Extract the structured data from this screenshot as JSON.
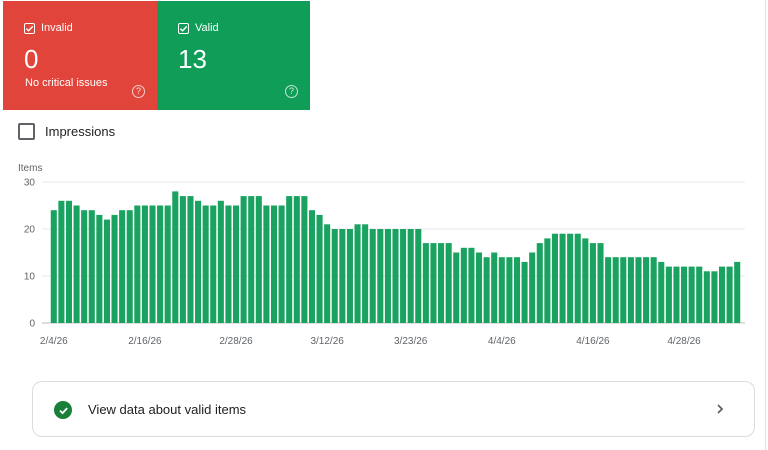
{
  "cards": {
    "invalid": {
      "label": "Invalid",
      "count": "0",
      "sub": "No critical issues",
      "color": "#e0443a",
      "checked": true,
      "help_icon": "help-icon"
    },
    "valid": {
      "label": "Valid",
      "count": "13",
      "color": "#0f9d58",
      "checked": true,
      "help_icon": "help-icon"
    }
  },
  "impressions": {
    "label": "Impressions",
    "checked": false
  },
  "chart_data": {
    "type": "bar",
    "ylabel": "Items",
    "ylim": [
      0,
      30
    ],
    "yticks": [
      0,
      10,
      20,
      30
    ],
    "grid": true,
    "color": "#1aa260",
    "xtick_labels": [
      "2/4/26",
      "2/16/26",
      "2/28/26",
      "3/12/26",
      "3/23/26",
      "4/4/26",
      "4/16/26",
      "4/28/26"
    ],
    "xtick_positions": [
      0,
      12,
      24,
      36,
      47,
      59,
      71,
      83
    ],
    "values": [
      24,
      26,
      26,
      25,
      24,
      24,
      23,
      22,
      23,
      24,
      24,
      25,
      25,
      25,
      25,
      25,
      28,
      27,
      27,
      26,
      25,
      25,
      26,
      25,
      25,
      27,
      27,
      27,
      25,
      25,
      25,
      27,
      27,
      27,
      24,
      23,
      21,
      20,
      20,
      20,
      21,
      21,
      20,
      20,
      20,
      20,
      20,
      20,
      20,
      17,
      17,
      17,
      17,
      15,
      16,
      16,
      15,
      14,
      15,
      14,
      14,
      14,
      13,
      15,
      17,
      18,
      19,
      19,
      19,
      19,
      18,
      17,
      17,
      14,
      14,
      14,
      14,
      14,
      14,
      14,
      13,
      12,
      12,
      12,
      12,
      12,
      11,
      11,
      12,
      12,
      13
    ]
  },
  "details": {
    "label": "View data about valid items",
    "icon": "check-circle-icon",
    "arrow_icon": "chevron-right-icon"
  }
}
